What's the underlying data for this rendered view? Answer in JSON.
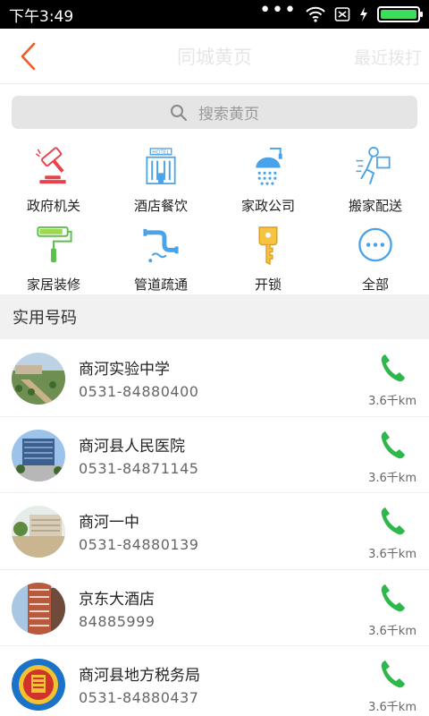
{
  "status": {
    "time": "下午3:49",
    "dots": "•••"
  },
  "header": {
    "title": "同城黄页",
    "recent": "最近拨打"
  },
  "search": {
    "placeholder": "搜索黄页"
  },
  "categories": [
    {
      "label": "政府机关",
      "icon": "gavel-icon"
    },
    {
      "label": "酒店餐饮",
      "icon": "hotel-icon"
    },
    {
      "label": "家政公司",
      "icon": "shower-icon"
    },
    {
      "label": "搬家配送",
      "icon": "mover-icon"
    },
    {
      "label": "家居装修",
      "icon": "paint-roller-icon"
    },
    {
      "label": "管道疏通",
      "icon": "pipe-icon"
    },
    {
      "label": "开锁",
      "icon": "key-icon"
    },
    {
      "label": "全部",
      "icon": "more-icon"
    }
  ],
  "hotel_sign": "HOTEL",
  "section_title": "实用号码",
  "contacts": [
    {
      "name": "商河实验中学",
      "phone": "0531-84880400",
      "distance": "3.6千km"
    },
    {
      "name": "商河县人民医院",
      "phone": "0531-84871145",
      "distance": "3.6千km"
    },
    {
      "name": "商河一中",
      "phone": "0531-84880139",
      "distance": "3.6千km"
    },
    {
      "name": "京东大酒店",
      "phone": "84885999",
      "distance": "3.6千km"
    },
    {
      "name": "商河县地方税务局",
      "phone": "0531-84880437",
      "distance": "3.6千km"
    }
  ],
  "colors": {
    "accent": "#f05a28",
    "call": "#2eb84b",
    "icon_blue": "#4aa3e8",
    "icon_red": "#e8424a"
  }
}
